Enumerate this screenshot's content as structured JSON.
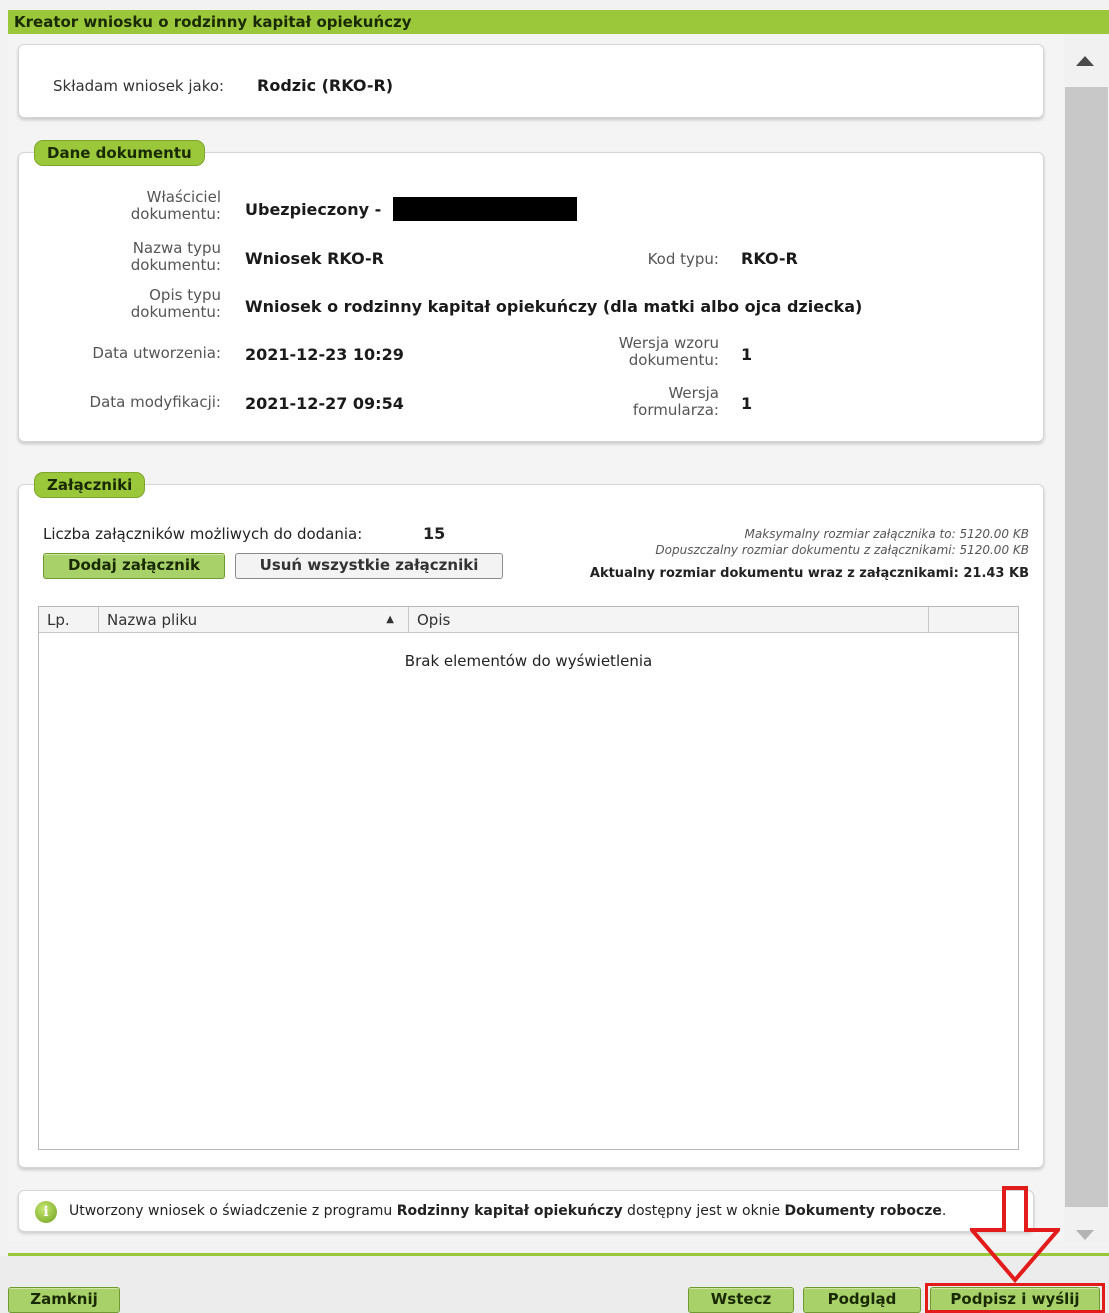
{
  "window": {
    "title": "Kreator wniosku o rodzinny kapitał opiekuńczy"
  },
  "applicant": {
    "label": "Składam wniosek jako:",
    "value": "Rodzic (RKO-R)"
  },
  "document_data": {
    "legend": "Dane dokumentu",
    "owner_label": "Właściciel dokumentu:",
    "owner_value": "Ubezpieczony -",
    "type_name_label": "Nazwa typu dokumentu:",
    "type_name_value": "Wniosek RKO-R",
    "type_code_label": "Kod typu:",
    "type_code_value": "RKO-R",
    "type_desc_label": "Opis typu dokumentu:",
    "type_desc_value": "Wniosek o rodzinny kapitał opiekuńczy (dla matki albo ojca dziecka)",
    "created_label": "Data utworzenia:",
    "created_value": "2021-12-23 10:29",
    "template_version_label": "Wersja wzoru dokumentu:",
    "template_version_value": "1",
    "modified_label": "Data modyfikacji:",
    "modified_value": "2021-12-27 09:54",
    "form_version_label": "Wersja formularza:",
    "form_version_value": "1"
  },
  "attachments": {
    "legend": "Załączniki",
    "count_label": "Liczba załączników możliwych do dodania:",
    "count_value": "15",
    "max_size_text": "Maksymalny rozmiar załącznika to: 5120.00 KB",
    "allowed_size_text": "Dopuszczalny rozmiar dokumentu z załącznikami: 5120.00 KB",
    "current_size_text": "Aktualny rozmiar dokumentu wraz z załącznikami: 21.43 KB",
    "add_button": "Dodaj załącznik",
    "remove_all_button": "Usuń wszystkie załączniki",
    "columns": [
      "Lp.",
      "Nazwa pliku",
      "Opis"
    ],
    "sort_indicator": "▲",
    "empty_text": "Brak elementów do wyświetlenia"
  },
  "info": {
    "text_1": "Utworzony wniosek o świadczenie z programu ",
    "text_2": "Rodzinny kapitał opiekuńczy",
    "text_3": " dostępny jest w oknie ",
    "text_4": "Dokumenty robocze",
    "text_5": "."
  },
  "footer": {
    "close_button": "Zamknij",
    "back_button": "Wstecz",
    "preview_button": "Podgląd",
    "sign_send_button": "Podpisz i wyślij"
  },
  "colors": {
    "accent": "#9bc73a",
    "highlight": "#e21b1b"
  }
}
